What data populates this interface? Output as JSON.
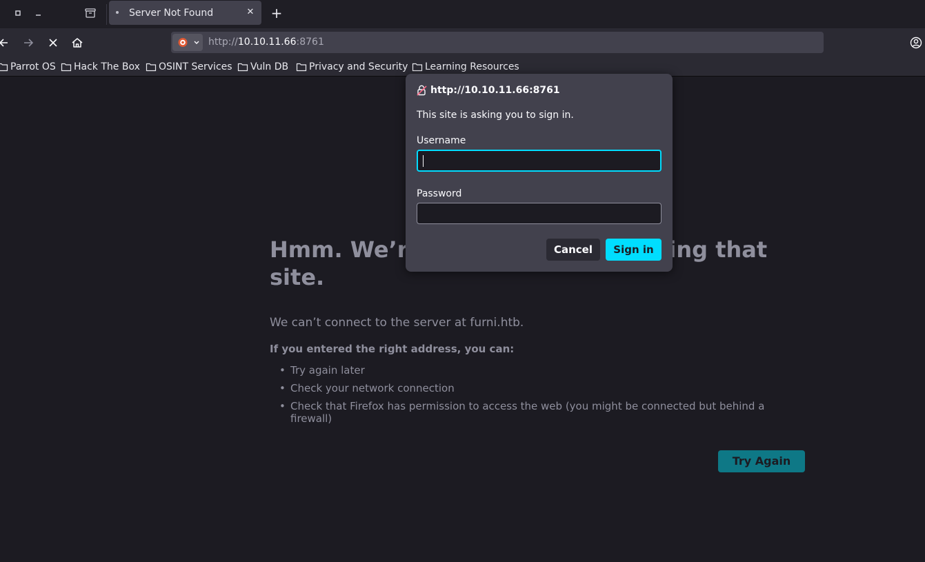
{
  "window": {
    "restore_icon": "restore-icon",
    "minimize_icon": "minimize-icon",
    "tab_list_icon": "tab-list-icon"
  },
  "tab": {
    "title": "Server Not Found",
    "close_glyph": "✕",
    "new_tab_glyph": "+"
  },
  "nav": {
    "url_scheme": "http://",
    "url_host": "10.10.11.66",
    "url_port": ":8761"
  },
  "bookmarks": [
    "Parrot OS",
    "Hack The Box",
    "OSINT Services",
    "Vuln DB",
    "Privacy and Security",
    "Learning Resources"
  ],
  "error": {
    "title": "Hmm. We’re having trouble finding that site.",
    "description": "We can’t connect to the server at furni.htb.",
    "subtitle": "If you entered the right address, you can:",
    "suggestions": [
      "Try again later",
      "Check your network connection",
      "Check that Firefox has permission to access the web (you might be connected but behind a firewall)"
    ],
    "try_again_label": "Try Again"
  },
  "dialog": {
    "origin": "http://10.10.11.66:8761",
    "message": "This site is asking you to sign in.",
    "username_label": "Username",
    "username_value": "",
    "password_label": "Password",
    "password_value": "",
    "cancel_label": "Cancel",
    "signin_label": "Sign in"
  },
  "colors": {
    "accent": "#00ddff",
    "page_background": "#1c1b22",
    "toolbar": "#2b2a33",
    "try_again": "#0e7886"
  }
}
